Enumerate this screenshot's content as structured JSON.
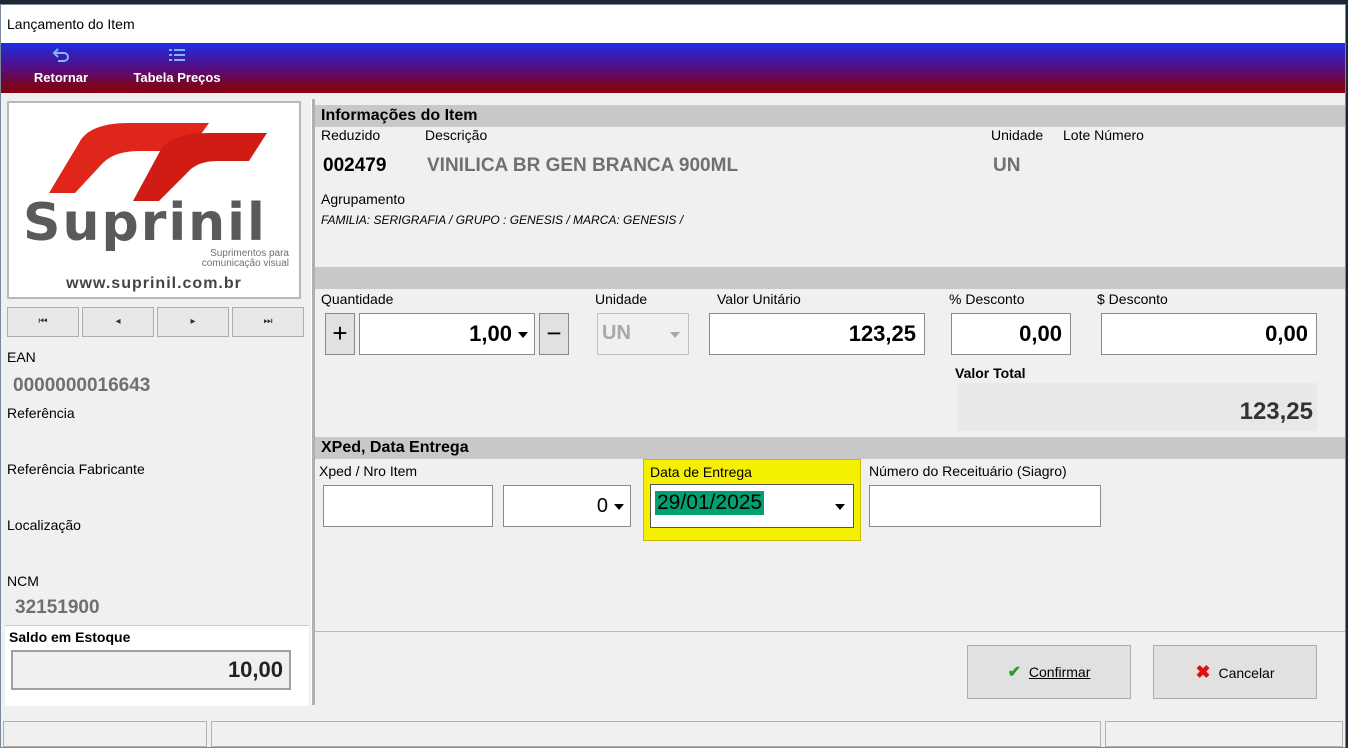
{
  "window": {
    "title": "Lançamento do Item"
  },
  "toolbar": {
    "back_label": "Retornar",
    "price_table_label": "Tabela Preços"
  },
  "logo": {
    "brand": "Suprinil",
    "tagline_1": "Suprimentos para",
    "tagline_2": "comunicação visual",
    "url": "www.suprinil.com.br",
    "red": "#e0251b",
    "gray": "#5a5a5a"
  },
  "nav": {
    "first": "⏮",
    "prev": "◂",
    "next": "▸",
    "last": "⏭"
  },
  "left": {
    "ean_label": "EAN",
    "ean_value": "0000000016643",
    "ref_label": "Referência",
    "ref_fab_label": "Referência Fabricante",
    "loc_label": "Localização",
    "ncm_label": "NCM",
    "ncm_value": "32151900",
    "stock_label": "Saldo em Estoque",
    "stock_value": "10,00"
  },
  "item_info": {
    "section_title": "Informações do Item",
    "code_label": "Reduzido",
    "code_value": "002479",
    "desc_label": "Descrição",
    "desc_value": "VINILICA BR GEN BRANCA 900ML",
    "unit_label": "Unidade",
    "unit_value": "UN",
    "lot_label": "Lote Número",
    "group_label": "Agrupamento",
    "group_value": "FAMILIA: SERIGRAFIA / GRUPO : GENESIS / MARCA: GENESIS /"
  },
  "pricing": {
    "qty_label": "Quantidade",
    "qty_value": "1,00",
    "plus": "+",
    "minus": "−",
    "unit_label": "Unidade",
    "unit_value": "UN",
    "unit_price_label": "Valor Unitário",
    "unit_price_value": "123,25",
    "disc_pct_label": "% Desconto",
    "disc_pct_value": "0,00",
    "disc_amt_label": "$ Desconto",
    "disc_amt_value": "0,00",
    "total_label": "Valor Total",
    "total_value": "123,25"
  },
  "xped": {
    "section_title": "XPed, Data Entrega",
    "xped_label": "Xped / Nro Item",
    "xped_value": "",
    "item_no_value": "0",
    "delivery_label": "Data de Entrega",
    "delivery_value": "29/01/2025",
    "receipt_label": "Número do Receituário (Siagro)",
    "receipt_value": "",
    "highlight_color": "#f5f000",
    "selection_color": "#00a070"
  },
  "actions": {
    "confirm_label": "Confirmar",
    "cancel_label": "Cancelar"
  }
}
